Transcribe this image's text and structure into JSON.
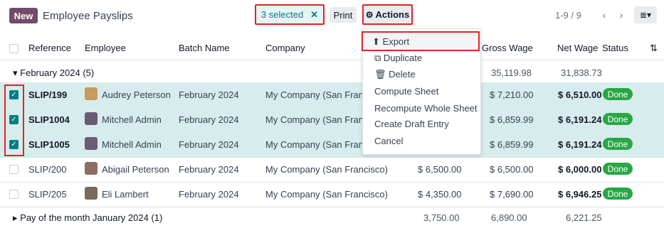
{
  "control_panel": {
    "new_label": "New",
    "title": "Employee Payslips",
    "selected_label": "3 selected",
    "clear_icon": "✕",
    "print_label": "Print",
    "actions_label": "Actions",
    "pager_text": "1-9 / 9",
    "prev_icon": "‹",
    "next_icon": "›",
    "view_icon": "≣▾"
  },
  "columns": {
    "reference": "Reference",
    "employee": "Employee",
    "batch": "Batch Name",
    "company": "Company",
    "gross": "Gross Wage",
    "net": "Net Wage",
    "status": "Status"
  },
  "groups": [
    {
      "label": "February 2024 (5)",
      "basic": "",
      "gross": "35,119.98",
      "net": "31,838.73"
    },
    {
      "label": "Pay of the month January 2024 (1)",
      "basic": "3,750.00",
      "gross": "6,890.00",
      "net": "6,221.25"
    }
  ],
  "rows": [
    {
      "ref": "SLIP/199",
      "employee": "Audrey Peterson",
      "batch": "February 2024",
      "company": "My Company (San Francis",
      "basic": "",
      "gross": "$ 7,210.00",
      "net": "$ 6,510.00",
      "status": "Done",
      "selected": true
    },
    {
      "ref": "SLIP1004",
      "employee": "Mitchell Admin",
      "batch": "February 2024",
      "company": "My Company (San Francis",
      "basic": "",
      "gross": "$ 6,859.99",
      "net": "$ 6,191.24",
      "status": "Done",
      "selected": true
    },
    {
      "ref": "SLIP1005",
      "employee": "Mitchell Admin",
      "batch": "February 2024",
      "company": "My Company (San Francis",
      "basic": "",
      "gross": "$ 6,859.99",
      "net": "$ 6,191.24",
      "status": "Done",
      "selected": true
    },
    {
      "ref": "SLIP/200",
      "employee": "Abigail Peterson",
      "batch": "February 2024",
      "company": "My Company (San Francisco)",
      "basic": "$ 6,500.00",
      "gross": "$ 6,500.00",
      "net": "$ 6,000.00",
      "status": "Done",
      "selected": false
    },
    {
      "ref": "SLIP/205",
      "employee": "Eli Lambert",
      "batch": "February 2024",
      "company": "My Company (San Francisco)",
      "basic": "$ 4,350.00",
      "gross": "$ 7,690.00",
      "net": "$ 6,946.25",
      "status": "Done",
      "selected": false
    }
  ],
  "actions_menu": {
    "export": "Export",
    "duplicate": "Duplicate",
    "delete": "Delete",
    "compute_sheet": "Compute Sheet",
    "recompute": "Recompute Whole Sheet",
    "draft_entry": "Create Draft Entry",
    "cancel": "Cancel"
  },
  "colors": {
    "accent": "#714b67",
    "teal": "#017e84",
    "done": "#28a745",
    "highlight": "#e02424"
  }
}
